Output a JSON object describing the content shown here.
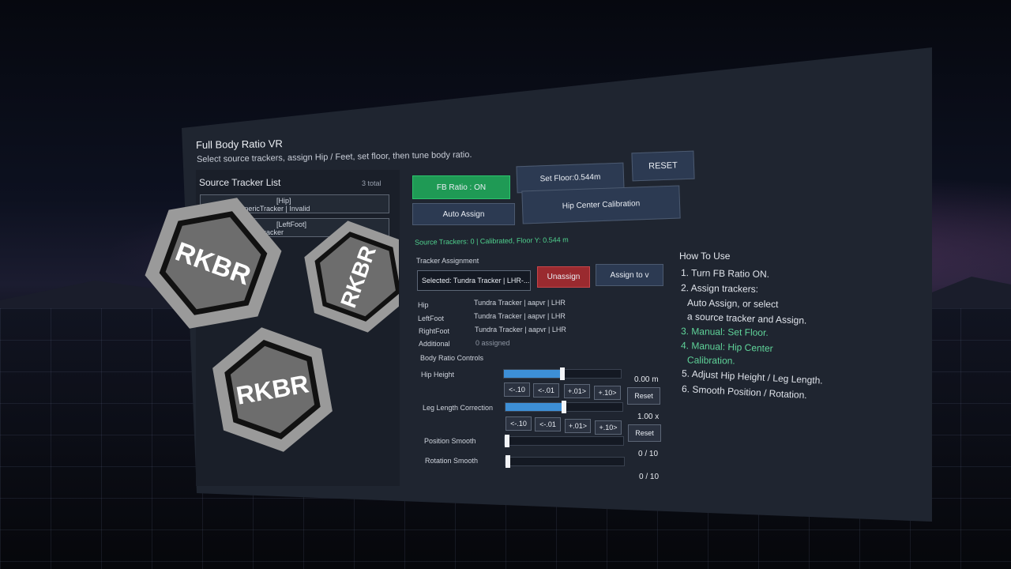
{
  "app": {
    "title": "Full Body Ratio VR",
    "subtitle": "Select source trackers, assign Hip / Feet, set floor, then tune body ratio."
  },
  "source_list": {
    "title": "Source Tracker List",
    "count": "3 total",
    "items": [
      {
        "label": "[Hip]",
        "detail": "LHR-… | GenericTracker | Invalid"
      },
      {
        "label": "[LeftFoot]",
        "detail": "LHR-… | GenericTracker"
      }
    ]
  },
  "controls": {
    "fb_ratio": "FB Ratio : ON",
    "set_floor": "Set Floor:0.544m",
    "reset": "RESET",
    "auto_assign": "Auto Assign",
    "hip_center": "Hip Center Calibration"
  },
  "status": "Source Trackers: 0 | Calibrated, Floor Y: 0.544 m",
  "assignment": {
    "title": "Tracker Assignment",
    "selected": "Selected: Tundra Tracker | LHR-...",
    "unassign": "Unassign",
    "assign_to": "Assign to v",
    "rows": [
      {
        "name": "Hip",
        "value": "Tundra Tracker | aapvr | LHR"
      },
      {
        "name": "LeftFoot",
        "value": "Tundra Tracker | aapvr | LHR"
      },
      {
        "name": "RightFoot",
        "value": "Tundra Tracker | aapvr | LHR"
      },
      {
        "name": "Additional",
        "value": "0 assigned"
      }
    ]
  },
  "body_ratio": {
    "title": "Body Ratio Controls",
    "hip_height": {
      "label": "Hip Height",
      "value": "0.00 m",
      "level": 0.5
    },
    "leg_length": {
      "label": "Leg Length Correction",
      "value": "1.00 x",
      "level": 0.5
    },
    "position_smooth": {
      "label": "Position Smooth",
      "value": "0 / 10",
      "level": 0
    },
    "rotation_smooth": {
      "label": "Rotation Smooth",
      "value": "0 / 10",
      "level": 0
    },
    "step_buttons": [
      "<-.10",
      "<-.01",
      "+.01>",
      "+.10>"
    ],
    "reset": "Reset"
  },
  "howto": {
    "title": "How To Use",
    "steps": [
      "1. Turn FB Ratio ON.",
      "2. Assign trackers:",
      "Auto Assign, or select",
      "a source tracker and Assign.",
      "3. Manual: Set Floor.",
      "4. Manual: Hip Center",
      "Calibration.",
      "5. Adjust Hip Height / Leg Length.",
      "6. Smooth Position / Rotation."
    ]
  },
  "logo": {
    "text": "RKBR"
  }
}
